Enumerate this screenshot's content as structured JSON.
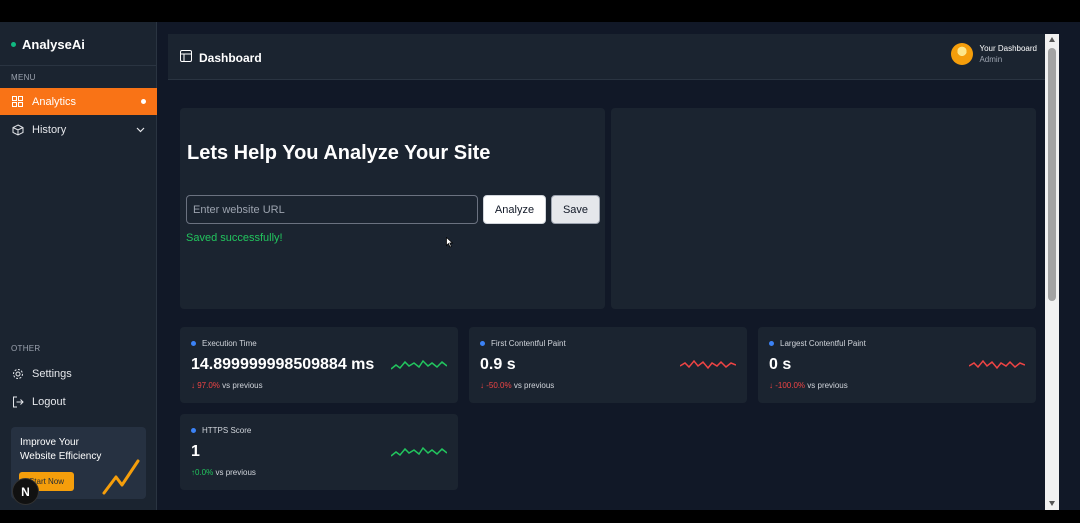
{
  "brand": "AnalyseAi",
  "sidebar": {
    "menu_label": "MENU",
    "items": [
      {
        "label": "Analytics",
        "icon": "grid-icon",
        "active": true
      },
      {
        "label": "History",
        "icon": "box-icon"
      }
    ],
    "other_label": "OTHER",
    "other_items": [
      {
        "label": "Settings",
        "icon": "gear-icon"
      },
      {
        "label": "Logout",
        "icon": "logout-icon"
      }
    ],
    "promo": {
      "text": "Improve Your Website Efficiency",
      "button": "Start Now"
    },
    "badge": "N"
  },
  "header": {
    "title": "Dashboard",
    "user_name": "Your Dashboard",
    "user_role": "Admin"
  },
  "hero": {
    "title": "Lets Help You Analyze Your Site",
    "url_placeholder": "Enter website URL",
    "analyze_label": "Analyze",
    "save_label": "Save",
    "status_message": "Saved successfully!"
  },
  "metrics": [
    {
      "label": "Execution Time",
      "value": "14.899999998509884 ms",
      "change": "97.0%",
      "direction": "up",
      "suffix": "vs previous",
      "trend_color": "#22c55e"
    },
    {
      "label": "First Contentful Paint",
      "value": "0.9 s",
      "change": "-50.0%",
      "direction": "down",
      "suffix": "vs previous",
      "trend_color": "#ef4444"
    },
    {
      "label": "Largest Contentful Paint",
      "value": "0 s",
      "change": "-100.0%",
      "direction": "down",
      "suffix": "vs previous",
      "trend_color": "#ef4444"
    },
    {
      "label": "HTTPS Score",
      "value": "1",
      "change": "0.0%",
      "direction": "up",
      "suffix": "vs previous",
      "trend_color": "#22c55e"
    }
  ],
  "colors": {
    "accent": "#f97316",
    "positive": "#22c55e",
    "negative": "#ef4444",
    "background": "#111827",
    "panel": "#1b2430"
  }
}
